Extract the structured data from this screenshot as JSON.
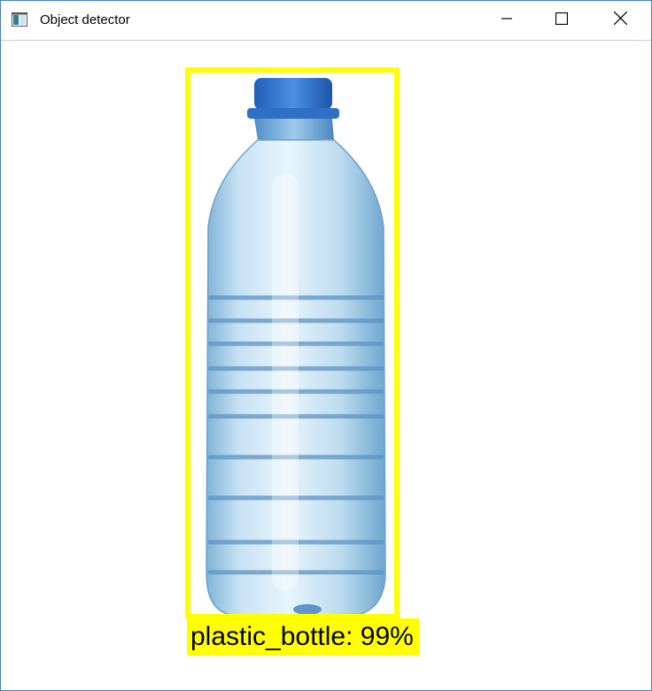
{
  "window": {
    "title": "Object detector"
  },
  "icons": {
    "app": "app-window-icon",
    "minimize": "minimize-icon",
    "maximize": "maximize-icon",
    "close": "close-icon"
  },
  "detection": {
    "label": "plastic_bottle: 99%",
    "box_color": "#ffff00",
    "label_bg": "#ffff00"
  }
}
